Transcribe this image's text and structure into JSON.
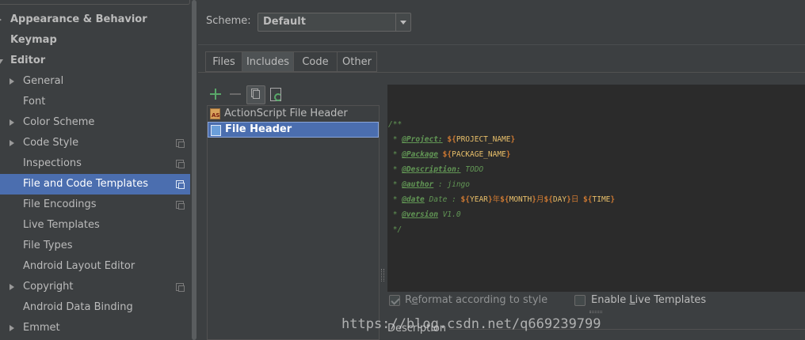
{
  "tree": {
    "items": [
      {
        "label": "Appearance & Behavior",
        "bold": true,
        "arrow": "right",
        "indent": 0
      },
      {
        "label": "Keymap",
        "bold": true,
        "arrow": "",
        "indent": 0
      },
      {
        "label": "Editor",
        "bold": true,
        "arrow": "down",
        "indent": 0
      },
      {
        "label": "General",
        "arrow": "right",
        "indent": 1
      },
      {
        "label": "Font",
        "arrow": "",
        "indent": 1
      },
      {
        "label": "Color Scheme",
        "arrow": "right",
        "indent": 1
      },
      {
        "label": "Code Style",
        "arrow": "right",
        "indent": 1,
        "copy_icon": true
      },
      {
        "label": "Inspections",
        "arrow": "",
        "indent": 1,
        "copy_icon": true
      },
      {
        "label": "File and Code Templates",
        "arrow": "",
        "indent": 1,
        "copy_icon": true,
        "selected": true
      },
      {
        "label": "File Encodings",
        "arrow": "",
        "indent": 1,
        "copy_icon": true
      },
      {
        "label": "Live Templates",
        "arrow": "",
        "indent": 1
      },
      {
        "label": "File Types",
        "arrow": "",
        "indent": 1
      },
      {
        "label": "Android Layout Editor",
        "arrow": "",
        "indent": 1
      },
      {
        "label": "Copyright",
        "arrow": "right",
        "indent": 1,
        "copy_icon": true
      },
      {
        "label": "Android Data Binding",
        "arrow": "",
        "indent": 1
      },
      {
        "label": "Emmet",
        "arrow": "right",
        "indent": 1
      }
    ]
  },
  "scheme": {
    "label": "Scheme:",
    "value": "Default"
  },
  "tabs": [
    {
      "label": "Files"
    },
    {
      "label": "Includes",
      "active": true
    },
    {
      "label": "Code"
    },
    {
      "label": "Other"
    }
  ],
  "toolbar": {
    "add_icon": "plus-icon",
    "remove_icon": "minus-icon",
    "copy_icon": "copy-icon",
    "reset_icon": "reset-icon"
  },
  "templates": [
    {
      "label": "ActionScript File Header",
      "icon": "actionscript-file-icon"
    },
    {
      "label": "File Header",
      "icon": "file-icon",
      "selected": true
    }
  ],
  "editor": {
    "lines": [
      [
        {
          "t": "/**",
          "c": "c"
        }
      ],
      [
        {
          "t": " * ",
          "c": "c"
        },
        {
          "t": "@Project:",
          "c": "ct"
        },
        {
          "t": " ",
          "c": "c"
        },
        {
          "t": "${",
          "c": "v"
        },
        {
          "t": "PROJECT_NAME",
          "c": "vn"
        },
        {
          "t": "}",
          "c": "v"
        }
      ],
      [
        {
          "t": " * ",
          "c": "c"
        },
        {
          "t": "@Package",
          "c": "ct"
        },
        {
          "t": " ",
          "c": "c"
        },
        {
          "t": "${",
          "c": "v"
        },
        {
          "t": "PACKAGE_NAME",
          "c": "vn"
        },
        {
          "t": "}",
          "c": "v"
        }
      ],
      [
        {
          "t": " * ",
          "c": "c"
        },
        {
          "t": "@Description:",
          "c": "ct"
        },
        {
          "t": " TODO",
          "c": "c"
        }
      ],
      [
        {
          "t": " * ",
          "c": "c"
        },
        {
          "t": "@author",
          "c": "ct"
        },
        {
          "t": " : jingo",
          "c": "c"
        }
      ],
      [
        {
          "t": " * ",
          "c": "c"
        },
        {
          "t": "@date",
          "c": "ct"
        },
        {
          "t": " Date : ",
          "c": "c"
        },
        {
          "t": "${",
          "c": "v"
        },
        {
          "t": "YEAR",
          "c": "vn"
        },
        {
          "t": "}",
          "c": "v"
        },
        {
          "t": "年",
          "c": "ml"
        },
        {
          "t": "${",
          "c": "v"
        },
        {
          "t": "MONTH",
          "c": "vn"
        },
        {
          "t": "}",
          "c": "v"
        },
        {
          "t": "月",
          "c": "ml"
        },
        {
          "t": "${",
          "c": "v"
        },
        {
          "t": "DAY",
          "c": "vn"
        },
        {
          "t": "}",
          "c": "v"
        },
        {
          "t": "日 ",
          "c": "ml"
        },
        {
          "t": "${",
          "c": "v"
        },
        {
          "t": "TIME",
          "c": "vn"
        },
        {
          "t": "}",
          "c": "v"
        }
      ],
      [
        {
          "t": " * ",
          "c": "c"
        },
        {
          "t": "@version",
          "c": "ct"
        },
        {
          "t": " V1.0",
          "c": "c"
        }
      ],
      [
        {
          "t": " */",
          "c": "c"
        }
      ]
    ]
  },
  "options": {
    "reformat": {
      "pre": "R",
      "mnemonic": "e",
      "post": "format according to style",
      "checked": true,
      "enabled": false
    },
    "live_templates": {
      "pre": "Enable ",
      "mnemonic": "L",
      "post": "ive Templates",
      "checked": false,
      "enabled": true
    }
  },
  "description": {
    "label": "Description"
  },
  "watermark": "https://blog.csdn.net/q669239799"
}
